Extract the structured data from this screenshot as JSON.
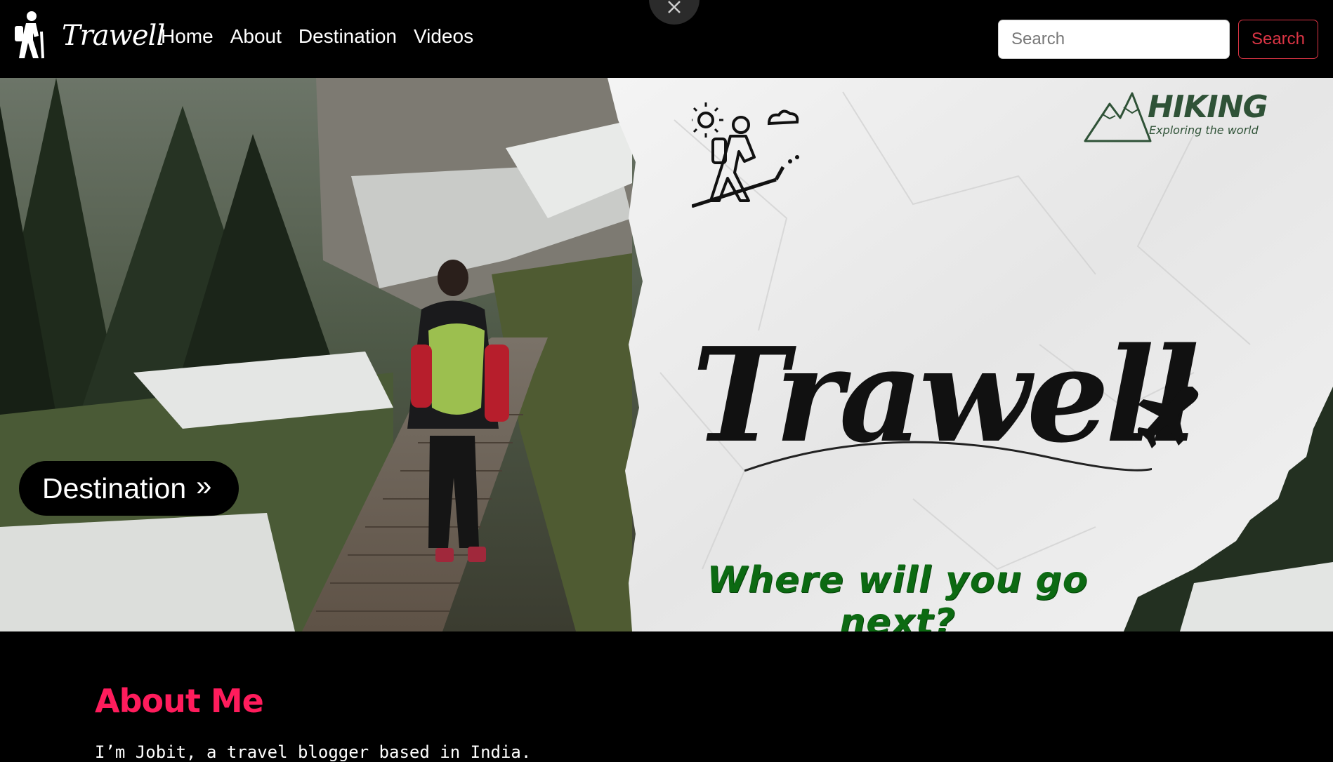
{
  "navbar": {
    "brand": "Trawell",
    "brand_icon": "hiker-icon",
    "links": [
      "Home",
      "About",
      "Destination",
      "Videos"
    ],
    "search_placeholder": "Search",
    "search_button": "Search",
    "close_icon": "close-icon"
  },
  "hero": {
    "destination_button": "Destination",
    "destination_chevron": "»",
    "title": "Trawell",
    "tagline": "Where will you go next?",
    "badge_word": "HIKING",
    "badge_sub": "Exploring the world"
  },
  "about": {
    "heading": "About Me",
    "text": "I’m Jobit, a travel blogger based in India."
  },
  "colors": {
    "accent": "#ff1c5c",
    "search_button": "#dc3545",
    "tagline_green": "#0c6a12",
    "hiking_green": "#2f5237"
  }
}
